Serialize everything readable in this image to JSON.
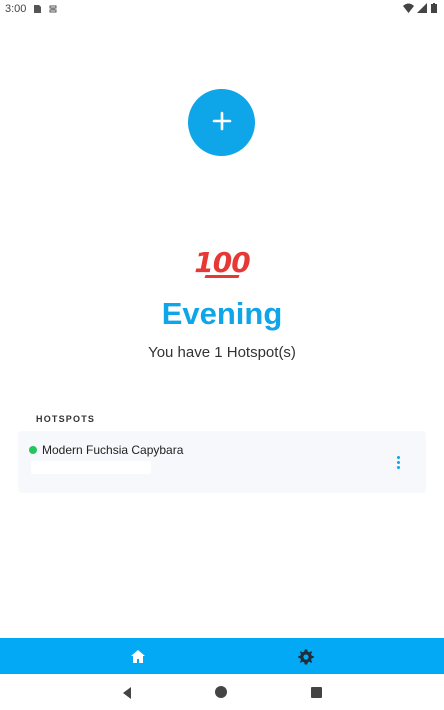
{
  "status_bar": {
    "time": "3:00"
  },
  "icons": {
    "sd_card": "sd-card-icon",
    "sync": "sync-icon",
    "wifi": "wifi-icon",
    "signal": "signal-icon",
    "battery": "battery-icon",
    "add": "plus-icon",
    "home": "home-icon",
    "settings": "gear-icon"
  },
  "main": {
    "emoji": "100",
    "greeting": "Evening",
    "subtitle": "You have 1 Hotspot(s)"
  },
  "hotspots": {
    "section_title": "HOTSPOTS",
    "items": [
      {
        "name": "Modern Fuchsia Capybara",
        "status_color": "#22c55e"
      }
    ]
  },
  "colors": {
    "accent": "#0ea5e9",
    "nav_bar": "#03a9f4",
    "online": "#22c55e"
  }
}
